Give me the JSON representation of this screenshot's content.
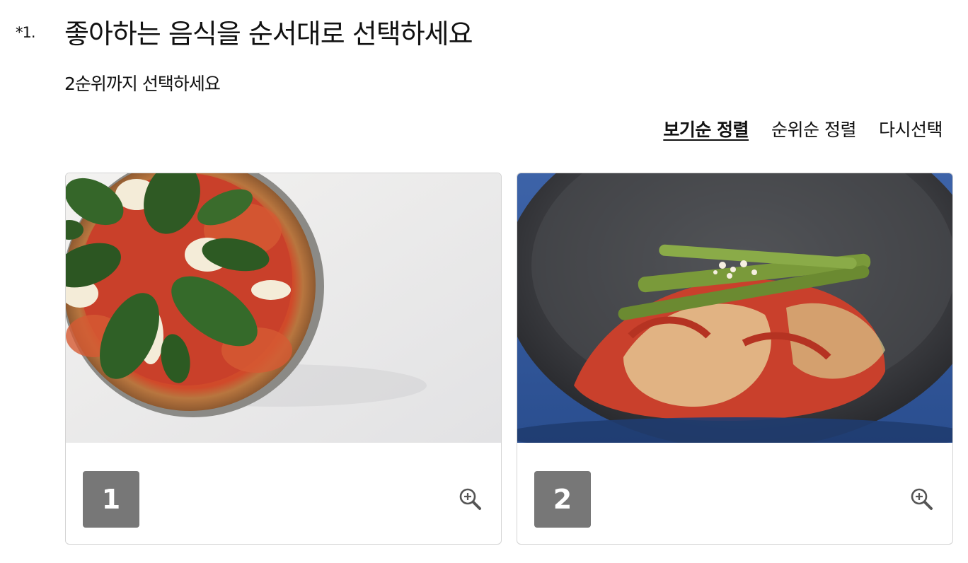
{
  "question": {
    "number": "*1.",
    "title": "좋아하는 음식을 순서대로 선택하세요",
    "hint": "2순위까지 선택하세요"
  },
  "sort": {
    "view_order": "보기순 정렬",
    "rank_order": "순위순 정렬",
    "reset": "다시선택",
    "active": "view_order"
  },
  "options": [
    {
      "rank_label": "1",
      "image": "pizza margherita",
      "zoom_icon": "zoom-in-icon"
    },
    {
      "rank_label": "2",
      "image": "kimchi in dark bowl",
      "zoom_icon": "zoom-in-icon"
    }
  ],
  "colors": {
    "badge": "#777777",
    "border": "#d4d4d4",
    "text": "#111111"
  }
}
